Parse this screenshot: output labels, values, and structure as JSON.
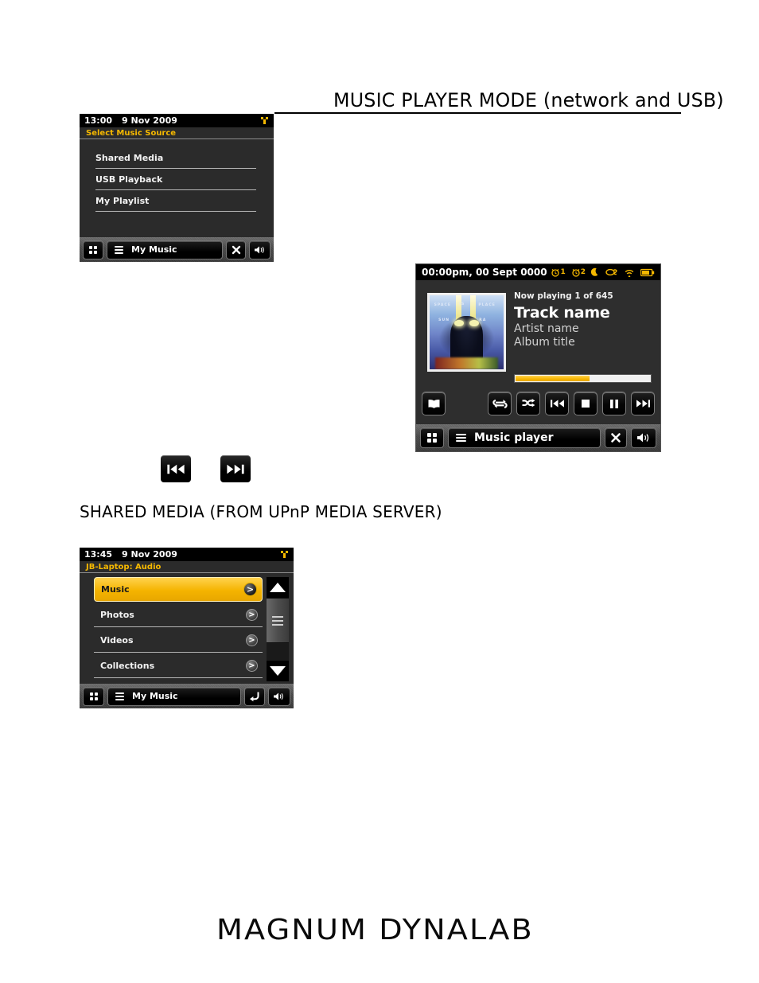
{
  "document": {
    "main_heading": "MUSIC PLAYER MODE (network and USB)",
    "section_heading": "SHARED MEDIA (FROM UPnP MEDIA SERVER)",
    "brand": "MAGNUM DYNALAB"
  },
  "colors": {
    "accent_yellow": "#f5b800",
    "screen_background": "#2b2b2b",
    "statusbar_background": "#000000",
    "text_primary": "#f2f2f2",
    "selected_row_text": "#1a1a1a"
  },
  "select_source_screen": {
    "statusbar": {
      "time": "13:00",
      "date": "9 Nov 2009",
      "signal_icon": "wifi-signal-icon"
    },
    "title": "Select Music Source",
    "items": [
      {
        "label": "Shared Media"
      },
      {
        "label": "USB Playback"
      },
      {
        "label": "My Playlist"
      }
    ],
    "toolbar": {
      "grid_icon": "grid-four-dots-icon",
      "menu_icon": "hamburger-menu-icon",
      "title": "My Music",
      "close_icon": "close-x-icon",
      "volume_icon": "speaker-volume-icon"
    }
  },
  "music_player_screen": {
    "statusbar": {
      "datetime": "00:00pm, 00 Sept 0000",
      "icons": [
        {
          "name": "alarm-1-icon",
          "label": "1"
        },
        {
          "name": "alarm-2-icon",
          "label": "2"
        },
        {
          "name": "sleep-moon-icon",
          "label": ""
        },
        {
          "name": "snooze-icon",
          "label": ""
        },
        {
          "name": "wifi-icon",
          "label": ""
        },
        {
          "name": "battery-icon",
          "label": ""
        }
      ]
    },
    "album_art": {
      "name": "album-art-thumbnail",
      "line_1": "SPACE",
      "line_2": "IS",
      "line_3": "THE",
      "line_4": "PLACE",
      "artist_line_left": "SUN",
      "artist_line_right": "RA"
    },
    "now_playing_count": "Now playing 1 of 645",
    "track": "Track name",
    "artist": "Artist name",
    "album": "Album title",
    "progress_percent": 55,
    "transport": [
      {
        "name": "browse-book-button",
        "icon": "open-book-icon"
      },
      {
        "name": "repeat-button",
        "icon": "repeat-icon"
      },
      {
        "name": "shuffle-button",
        "icon": "shuffle-icon"
      },
      {
        "name": "previous-track-button",
        "icon": "skip-back-icon"
      },
      {
        "name": "stop-button",
        "icon": "stop-square-icon"
      },
      {
        "name": "pause-button",
        "icon": "pause-icon"
      },
      {
        "name": "next-track-button",
        "icon": "skip-forward-icon"
      }
    ],
    "toolbar": {
      "grid_icon": "grid-four-dots-icon",
      "menu_icon": "hamburger-menu-icon",
      "title": "Music player",
      "close_icon": "close-x-icon",
      "volume_icon": "speaker-volume-icon"
    }
  },
  "standalone_buttons": [
    {
      "name": "previous-track-button",
      "icon": "skip-back-icon"
    },
    {
      "name": "next-track-button",
      "icon": "skip-forward-icon"
    }
  ],
  "shared_media_screen": {
    "statusbar": {
      "time": "13:45",
      "date": "9 Nov 2009",
      "signal_icon": "wifi-signal-icon"
    },
    "title": "JB-Laptop: Audio",
    "items": [
      {
        "label": "Music",
        "selected": true,
        "chevron": ">"
      },
      {
        "label": "Photos",
        "selected": false,
        "chevron": ">"
      },
      {
        "label": "Videos",
        "selected": false,
        "chevron": ">"
      },
      {
        "label": "Collections",
        "selected": false,
        "chevron": ">"
      }
    ],
    "scrollbar": {
      "up_icon": "scroll-up-arrow-icon",
      "thumb_icon": "scroll-thumb-grip-icon",
      "down_icon": "scroll-down-arrow-icon"
    },
    "toolbar": {
      "grid_icon": "grid-four-dots-icon",
      "menu_icon": "hamburger-menu-icon",
      "title": "My Music",
      "back_icon": "back-arrow-icon",
      "volume_icon": "speaker-volume-icon"
    }
  }
}
